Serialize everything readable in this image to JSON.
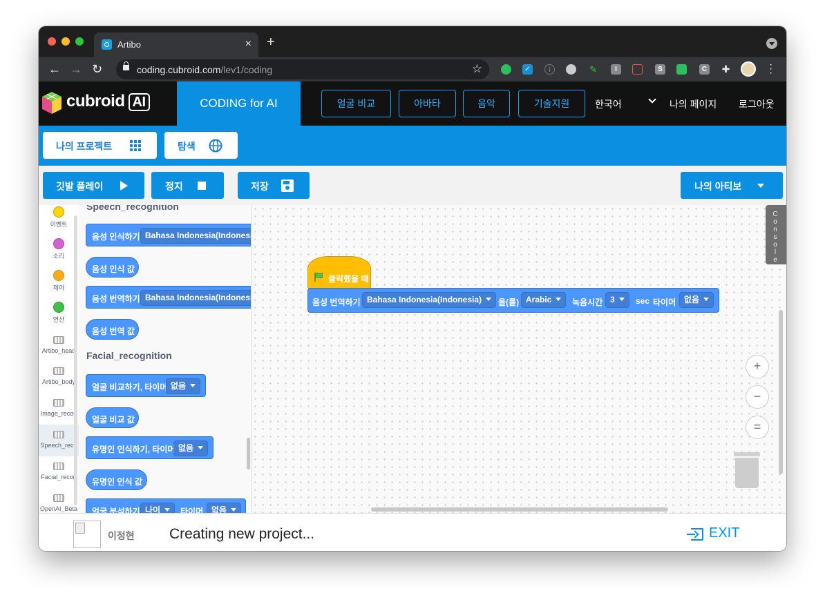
{
  "browser": {
    "tab_title": "Artibo",
    "tab_close": "×",
    "new_tab": "+",
    "url_host": "coding.cubroid.com",
    "url_path": "/lev1/coding",
    "star": "☆",
    "back": "←",
    "forward": "→",
    "reload": "↻",
    "extensions": [
      "evernote-icon",
      "checkmark-icon",
      "info-icon",
      "globe-icon",
      "pen-icon",
      "I",
      "bot-icon",
      "S",
      "keyboard-icon",
      "C",
      "puzzle-icon"
    ]
  },
  "header": {
    "logo_text": "cubroid",
    "logo_ai": "AI",
    "coding_tab": "CODING for AI",
    "nav": [
      "얼굴 비교",
      "아바타",
      "음악",
      "기술지원"
    ],
    "language": "한국어",
    "mypage": "나의 페이지",
    "logout": "로그아웃"
  },
  "subnav": {
    "my_projects": "나의 프로젝트",
    "explore": "탐색"
  },
  "controls": {
    "flag_play": "깃발 플레이",
    "stop": "정지",
    "save": "저장",
    "my_artibo": "나의 아티보"
  },
  "categories": [
    {
      "label": "이벤트",
      "color": "#ffd500"
    },
    {
      "label": "소리",
      "color": "#cf63cf"
    },
    {
      "label": "제어",
      "color": "#ffab19"
    },
    {
      "label": "연산",
      "color": "#40bf4a"
    },
    {
      "label": "Artibo_head"
    },
    {
      "label": "Artibo_body"
    },
    {
      "label": "Image_recog"
    },
    {
      "label": "Speech_reco"
    },
    {
      "label": "Facial_recog"
    },
    {
      "label": "OpenAI_Beta"
    }
  ],
  "flyout": {
    "speech_heading": "Speech_recognition",
    "speech_recognize": "음성 인식하기",
    "speech_recognize_lang": "Bahasa Indonesia(Indonesia)",
    "speech_value": "음성 인식 값",
    "speech_translate": "음성 번역하기",
    "speech_translate_lang": "Bahasa Indonesia(Indonesia)",
    "translate_value": "음성 번역 값",
    "facial_heading": "Facial_recognition",
    "face_compare": "얼굴 비교하기, 타이머",
    "face_compare_opt": "없음",
    "face_compare_value": "얼굴 비교 값",
    "celeb_recognize": "유명인 인식하기, 타이머",
    "celeb_recognize_opt": "없음",
    "celeb_value": "유명인 인식 값",
    "face_analyze": "얼굴 분석하기",
    "face_analyze_opt": "나이",
    "face_analyze_timer": "타이머",
    "face_analyze_timer_opt": "없음"
  },
  "script": {
    "hat": "클릭했을 때",
    "block_label": "음성 번역하기",
    "from_lang": "Bahasa Indonesia(Indonesia)",
    "from_suffix": "을(를)",
    "to_lang": "Arabic",
    "record_label": "녹음시간",
    "record_value": "3",
    "sec_label": "sec",
    "timer_label": "타이머",
    "timer_value": "없음"
  },
  "console_label": "Console",
  "zoom": {
    "in": "+",
    "out": "−",
    "reset": "="
  },
  "footer": {
    "username": "이정현",
    "status": "Creating new project...",
    "exit": "EXIT"
  }
}
